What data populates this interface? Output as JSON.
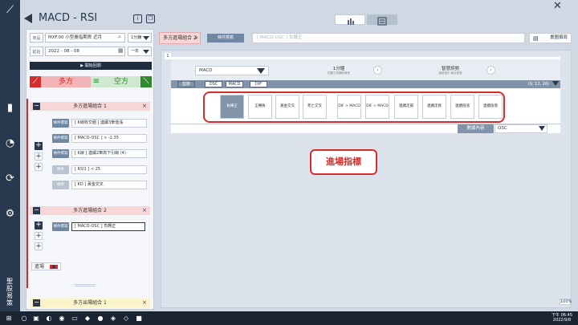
{
  "title_bar": {
    "title": "MACD - RSI"
  },
  "left_panel": {
    "product_label": "商品",
    "product_value": "MXF.00 小型臺指期貨 近月",
    "interval_value": "1分鐘",
    "date_label": "起始",
    "date_value": "2022 - 08 - 08",
    "range_value": "一年",
    "play_label": "▶ 開始回測",
    "tab_long": "多方",
    "tab_short": "空方",
    "groups": [
      {
        "title": "多方進場組合 1",
        "conditions": [
          {
            "btn": "條件撰寫",
            "text": "[ K線收交圈 ] 連續3筆值漲"
          },
          {
            "btn": "條件撰寫",
            "text": "[ MACD-OSC ] > -2.35"
          },
          {
            "btn": "條件撰寫",
            "text": "[ K線 ] 連續2筆高下引線 (4)"
          },
          {
            "btn": "條件",
            "text": "[ RSI1 ] < 25"
          },
          {
            "btn": "條件",
            "text": "[ KD ] 黃金交叉"
          }
        ]
      },
      {
        "title": "多方進場組合 2",
        "conditions": [
          {
            "btn": "條件撰寫",
            "text": "[ MACD-OSC ] 負轉正"
          }
        ]
      },
      {
        "title": "多方出場組合 1",
        "conditions": []
      }
    ],
    "enter_label": "進場"
  },
  "right_panel": {
    "combo_tab": "多方進場組合 2",
    "combo_close": "×",
    "enter_condition_btn": "條件撰寫",
    "condition_placeholder": "[ MACD-OSC ] 負轉正",
    "draw_btn": "畫圖撰寫",
    "panel_num": "1",
    "indicator": "MACD",
    "period_title": "1分鐘",
    "period_sub": "把握交易賺取機會",
    "trend_title": "智慧抓勢",
    "trend_sub": "趨勢指引 最佳進場",
    "subtabs": [
      "型態",
      "OSC",
      "MACD",
      "DIF"
    ],
    "params": "(9, 12, 26)",
    "signals": [
      "負轉正",
      "正轉負",
      "黃金交叉",
      "死亡交叉",
      "DIF > MACD",
      "DIF < MACD",
      "連續走揚",
      "連續走跌",
      "連續值漲",
      "連續值落"
    ],
    "data_label": "數據內容",
    "data_value": "OSC",
    "callout": "進場指標",
    "zoom": "100%"
  },
  "taskbar": {
    "time": "下午 06:45",
    "date": "2022/9/8"
  },
  "rail": {
    "brand_text": "聖股易策"
  },
  "colors": {
    "accent_red": "#d62c2c",
    "dark_navy": "#27384f",
    "steel_blue": "#6f87a3",
    "long_pink": "#f6d6d6",
    "short_green": "#cfe8cf",
    "exit_yellow": "#fbf3c9"
  }
}
